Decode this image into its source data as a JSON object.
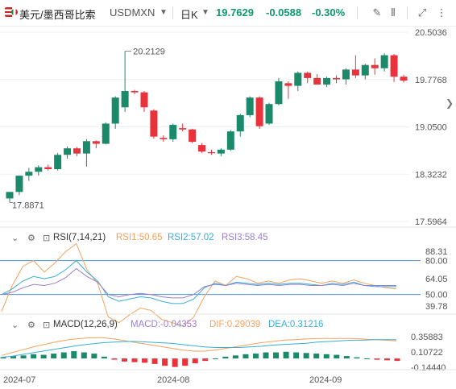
{
  "header": {
    "pair_name": "美元/墨西哥比索",
    "symbol": "USDMXN",
    "period": "日K",
    "price": "19.7629",
    "change": "-0.0588",
    "change_pct": "-0.30%",
    "icons": [
      "flag-icon",
      "dropdown-caret-icon",
      "period-caret-icon",
      "draw-icon",
      "indicator-icon",
      "settings-icon",
      "fullscreen-icon",
      "more-icon"
    ]
  },
  "price_axis": [
    "20.5036",
    "19.7768",
    "19.0500",
    "18.3232",
    "17.5964"
  ],
  "annotations": {
    "high_label": "20.2129",
    "low_label": "17.8871"
  },
  "rsi": {
    "title": "RSI(7,14,21)",
    "rsi1": "RSI1:50.65",
    "rsi2": "RSI2:57.02",
    "rsi3": "RSI3:58.45",
    "axis": [
      "88.31",
      "80.00",
      "64.05",
      "50.00",
      "39.78"
    ]
  },
  "macd": {
    "title": "MACD(12,26,9)",
    "macd": "MACD:-0.04353",
    "dif": "DIF:0.29039",
    "dea": "DEA:0.31216",
    "axis": [
      "0.35883",
      "0.10722",
      "-0.14440"
    ]
  },
  "x_axis": [
    "2024-07",
    "2024-08",
    "2024-09"
  ],
  "colors": {
    "up": "#1b8a6b",
    "down": "#e8323c",
    "rsi1": "#f5a25d",
    "rsi2": "#3aaed8",
    "rsi3": "#9a7fd1",
    "macd_up": "#1b8a6b",
    "macd_down": "#e8323c"
  },
  "chart_data": {
    "type": "candlestick",
    "candles": [
      {
        "o": 17.95,
        "h": 18.05,
        "l": 17.89,
        "c": 18.05
      },
      {
        "o": 18.05,
        "h": 18.3,
        "l": 18.0,
        "c": 18.3
      },
      {
        "o": 18.3,
        "h": 18.42,
        "l": 18.22,
        "c": 18.36
      },
      {
        "o": 18.36,
        "h": 18.46,
        "l": 18.3,
        "c": 18.43
      },
      {
        "o": 18.43,
        "h": 18.47,
        "l": 18.38,
        "c": 18.4
      },
      {
        "o": 18.4,
        "h": 18.65,
        "l": 18.38,
        "c": 18.62
      },
      {
        "o": 18.62,
        "h": 18.75,
        "l": 18.56,
        "c": 18.72
      },
      {
        "o": 18.72,
        "h": 18.74,
        "l": 18.6,
        "c": 18.64
      },
      {
        "o": 18.64,
        "h": 18.86,
        "l": 18.44,
        "c": 18.83
      },
      {
        "o": 18.83,
        "h": 18.84,
        "l": 18.72,
        "c": 18.79
      },
      {
        "o": 18.79,
        "h": 19.12,
        "l": 18.78,
        "c": 19.1
      },
      {
        "o": 19.1,
        "h": 19.52,
        "l": 19.02,
        "c": 19.5
      },
      {
        "o": 19.35,
        "h": 20.21,
        "l": 19.28,
        "c": 19.6
      },
      {
        "o": 19.6,
        "h": 19.62,
        "l": 19.55,
        "c": 19.58
      },
      {
        "o": 19.58,
        "h": 19.6,
        "l": 19.28,
        "c": 19.35
      },
      {
        "o": 19.3,
        "h": 19.32,
        "l": 18.87,
        "c": 18.9
      },
      {
        "o": 18.88,
        "h": 18.92,
        "l": 18.82,
        "c": 18.86
      },
      {
        "o": 18.86,
        "h": 19.1,
        "l": 18.82,
        "c": 19.08
      },
      {
        "o": 19.03,
        "h": 19.1,
        "l": 18.98,
        "c": 19.01
      },
      {
        "o": 19.01,
        "h": 19.02,
        "l": 18.8,
        "c": 18.82
      },
      {
        "o": 18.77,
        "h": 18.8,
        "l": 18.65,
        "c": 18.67
      },
      {
        "o": 18.66,
        "h": 18.7,
        "l": 18.62,
        "c": 18.65
      },
      {
        "o": 18.64,
        "h": 18.72,
        "l": 18.6,
        "c": 18.7
      },
      {
        "o": 18.7,
        "h": 19.0,
        "l": 18.68,
        "c": 18.98
      },
      {
        "o": 18.98,
        "h": 19.25,
        "l": 18.9,
        "c": 19.23
      },
      {
        "o": 19.23,
        "h": 19.52,
        "l": 19.2,
        "c": 19.5
      },
      {
        "o": 19.5,
        "h": 19.52,
        "l": 19.02,
        "c": 19.06
      },
      {
        "o": 19.1,
        "h": 19.42,
        "l": 19.08,
        "c": 19.4
      },
      {
        "o": 19.4,
        "h": 19.8,
        "l": 19.38,
        "c": 19.75
      },
      {
        "o": 19.72,
        "h": 19.75,
        "l": 19.48,
        "c": 19.68
      },
      {
        "o": 19.68,
        "h": 19.9,
        "l": 19.6,
        "c": 19.88
      },
      {
        "o": 19.88,
        "h": 19.9,
        "l": 19.72,
        "c": 19.8
      },
      {
        "o": 19.8,
        "h": 19.86,
        "l": 19.72,
        "c": 19.7
      },
      {
        "o": 19.7,
        "h": 19.82,
        "l": 19.66,
        "c": 19.8
      },
      {
        "o": 19.8,
        "h": 19.84,
        "l": 19.72,
        "c": 19.78
      },
      {
        "o": 19.78,
        "h": 19.95,
        "l": 19.7,
        "c": 19.93
      },
      {
        "o": 19.93,
        "h": 20.15,
        "l": 19.8,
        "c": 19.84
      },
      {
        "o": 19.84,
        "h": 20.02,
        "l": 19.78,
        "c": 20.0
      },
      {
        "o": 20.0,
        "h": 20.1,
        "l": 19.85,
        "c": 19.95
      },
      {
        "o": 19.95,
        "h": 20.18,
        "l": 19.9,
        "c": 20.15
      },
      {
        "o": 20.15,
        "h": 20.17,
        "l": 19.74,
        "c": 19.82
      },
      {
        "o": 19.82,
        "h": 19.85,
        "l": 19.73,
        "c": 19.76
      }
    ],
    "rsi1": [
      35,
      58,
      75,
      80,
      70,
      78,
      88,
      95,
      72,
      60,
      30,
      25,
      32,
      38,
      36,
      28,
      25,
      22,
      30,
      48,
      62,
      58,
      66,
      64,
      60,
      62,
      60,
      63,
      64,
      62,
      60,
      62,
      60,
      63,
      60,
      58,
      56,
      55
    ],
    "rsi2": [
      50,
      55,
      62,
      66,
      64,
      66,
      72,
      80,
      70,
      62,
      48,
      44,
      46,
      48,
      47,
      44,
      42,
      42,
      46,
      56,
      60,
      58,
      61,
      60,
      59,
      60,
      59,
      60,
      60,
      59,
      58,
      60,
      59,
      61,
      58,
      57,
      57,
      57
    ],
    "rsi3": [
      50,
      52,
      56,
      59,
      58,
      60,
      65,
      73,
      66,
      61,
      50,
      48,
      50,
      51,
      50,
      48,
      47,
      47,
      50,
      57,
      59,
      58,
      60,
      59,
      58,
      59,
      58,
      59,
      59,
      58,
      58,
      59,
      58,
      60,
      58,
      58,
      58,
      58
    ],
    "macd_hist": [
      0.02,
      0.04,
      0.05,
      0.07,
      0.06,
      0.08,
      0.1,
      0.12,
      0.1,
      0.08,
      0.03,
      -0.02,
      -0.05,
      -0.06,
      -0.07,
      -0.09,
      -0.12,
      -0.14,
      -0.12,
      -0.08,
      -0.04,
      0.0,
      0.03,
      0.05,
      0.07,
      0.08,
      0.1,
      0.1,
      0.11,
      0.1,
      0.09,
      0.08,
      0.07,
      0.06,
      0.04,
      0.02,
      0.0,
      -0.02,
      -0.03,
      -0.04
    ],
    "dif": [
      0.05,
      0.1,
      0.15,
      0.2,
      0.24,
      0.28,
      0.31,
      0.33,
      0.34,
      0.34,
      0.32,
      0.29,
      0.26,
      0.23,
      0.2,
      0.17,
      0.14,
      0.12,
      0.12,
      0.14,
      0.17,
      0.2,
      0.23,
      0.26,
      0.28,
      0.3,
      0.31,
      0.32,
      0.33,
      0.33,
      0.33,
      0.33,
      0.32,
      0.31,
      0.3,
      0.29
    ],
    "dea": [
      0.02,
      0.04,
      0.07,
      0.1,
      0.13,
      0.16,
      0.19,
      0.22,
      0.24,
      0.26,
      0.27,
      0.28,
      0.28,
      0.27,
      0.26,
      0.25,
      0.23,
      0.21,
      0.19,
      0.18,
      0.18,
      0.18,
      0.19,
      0.2,
      0.22,
      0.23,
      0.24,
      0.25,
      0.27,
      0.28,
      0.29,
      0.3,
      0.3,
      0.31,
      0.31,
      0.31
    ]
  }
}
